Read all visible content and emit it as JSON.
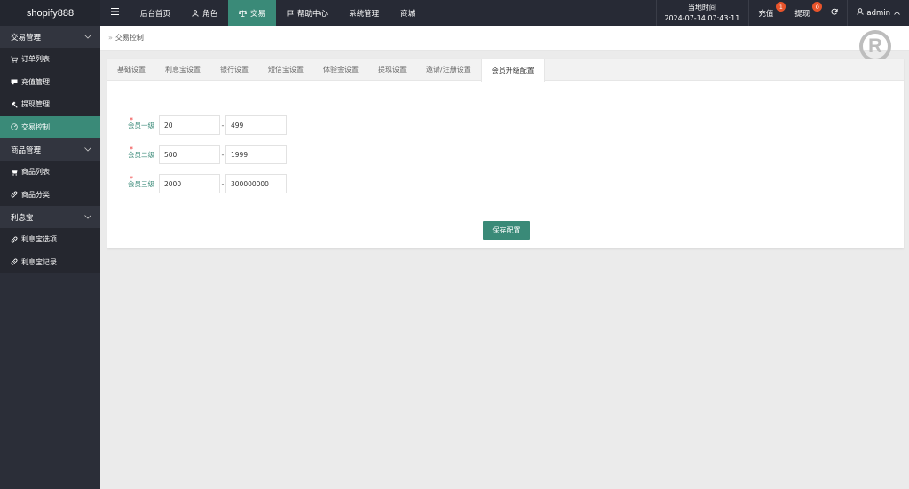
{
  "brand": "shopify888",
  "nav": {
    "home": "后台首页",
    "role": "角色",
    "trade": "交易",
    "help": "帮助中心",
    "system": "系统管理",
    "mall": "商城"
  },
  "topright": {
    "time_label": "当地时间",
    "time_value": "2024-07-14 07:43:11",
    "recharge": "充值",
    "recharge_count": "1",
    "withdraw": "提现",
    "withdraw_count": "0",
    "user": "admin"
  },
  "sidebar": {
    "group1": "交易管理",
    "items1": [
      "订单列表",
      "充值管理",
      "提现管理",
      "交易控制"
    ],
    "group2": "商品管理",
    "items2": [
      "商品列表",
      "商品分类"
    ],
    "group3": "利息宝",
    "items3": [
      "利息宝选项",
      "利息宝记录"
    ]
  },
  "breadcrumb": "交易控制",
  "tabs": [
    "基础设置",
    "利息宝设置",
    "银行设置",
    "短信宝设置",
    "体验金设置",
    "提现设置",
    "邀请/注册设置",
    "会员升级配置"
  ],
  "form": {
    "rows": [
      {
        "label": "会员一级",
        "min": "20",
        "max": "499"
      },
      {
        "label": "会员二级",
        "min": "500",
        "max": "1999"
      },
      {
        "label": "会员三级",
        "min": "2000",
        "max": "300000000"
      }
    ],
    "dash": "-",
    "save": "保存配置"
  },
  "colors": {
    "accent": "#3a8a78",
    "topbar": "#272a35",
    "sidebar": "#2b2e38",
    "badge": "#e8542b"
  }
}
